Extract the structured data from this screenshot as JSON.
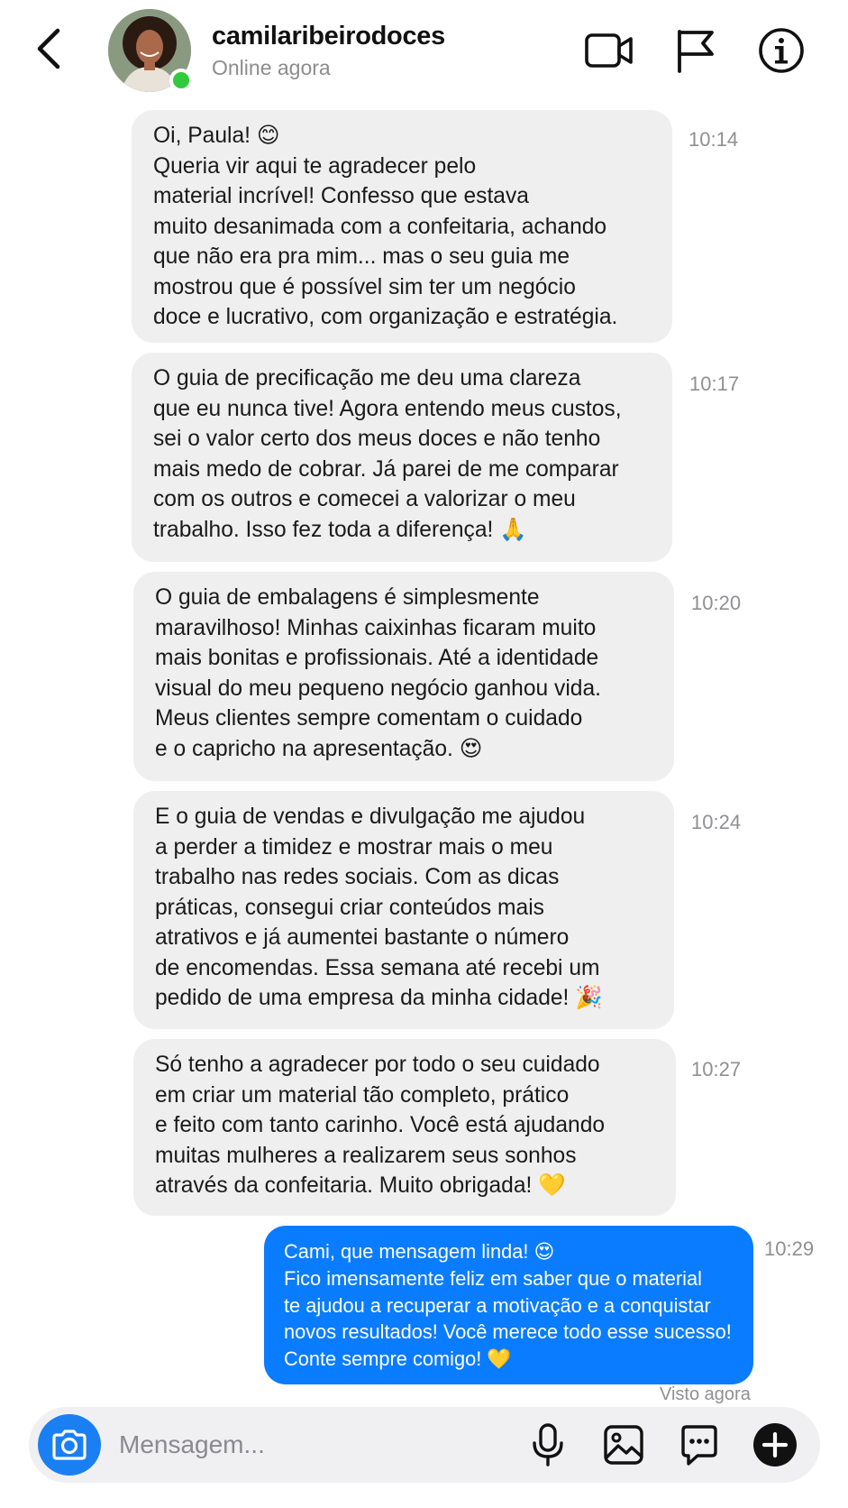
{
  "header": {
    "username": "camilaribeirodoces",
    "status": "Online agora"
  },
  "messages": [
    {
      "time": "10:14",
      "lines": [
        "Oi, Paula! 😊",
        "Queria vir aqui te agradecer pelo",
        "material incrível! Confesso que estava",
        "muito desanimada com a confeitaria, achando",
        "que não era pra mim... mas o seu guia me",
        "mostrou que é possível sim ter um negócio",
        "doce e lucrativo, com organização e estratégia."
      ]
    },
    {
      "time": "10:17",
      "lines": [
        "O guia de precificação me deu uma clareza",
        "que eu nunca tive! Agora entendo meus custos,",
        "sei o valor certo dos meus doces e não tenho",
        "mais medo de cobrar. Já parei de me comparar",
        "com os outros e comecei a valorizar o meu",
        "trabalho. Isso fez toda a diferença! 🙏"
      ]
    },
    {
      "time": "10:20",
      "lines": [
        "O guia de embalagens é simplesmente",
        "maravilhoso! Minhas caixinhas ficaram muito",
        "mais bonitas e profissionais. Até a identidade",
        "visual do meu pequeno negócio ganhou vida.",
        "Meus clientes sempre comentam o cuidado",
        "e o capricho na apresentação. 😍"
      ]
    },
    {
      "time": "10:24",
      "lines": [
        "E o guia de vendas e divulgação me ajudou",
        "a perder a timidez e mostrar mais o meu",
        "trabalho nas redes sociais. Com as dicas",
        "práticas, consegui criar conteúdos mais",
        "atrativos e já aumentei bastante o número",
        "de encomendas. Essa semana até recebi um",
        "pedido de uma empresa da minha cidade! 🎉"
      ]
    },
    {
      "time": "10:27",
      "lines": [
        "Só tenho a agradecer por todo o seu cuidado",
        "em criar um material tão completo, prático",
        "e feito com tanto carinho. Você está ajudando",
        "muitas mulheres a realizarem seus sonhos",
        "através da confeitaria. Muito obrigada! 💛"
      ]
    }
  ],
  "reply": {
    "time": "10:29",
    "lines": [
      "Cami, que mensagem linda! 😍",
      "Fico imensamente feliz em saber que o material",
      "te ajudou a recuperar a motivação e a conquistar",
      "novos resultados! Você merece todo esse sucesso!",
      "Conte sempre comigo! 💛"
    ],
    "seen": "Visto agora"
  },
  "composer": {
    "placeholder": "Mensagem..."
  },
  "colors": {
    "online": "#2fcb3c",
    "incoming_bubble": "#efeff0",
    "outgoing_bubble": "#0a7cff",
    "camera_button": "#1a7ff3"
  },
  "icons": [
    "back-chevron-icon",
    "video-call-icon",
    "flag-icon",
    "info-icon",
    "camera-icon",
    "microphone-icon",
    "gallery-icon",
    "sticker-chat-icon",
    "plus-icon"
  ]
}
